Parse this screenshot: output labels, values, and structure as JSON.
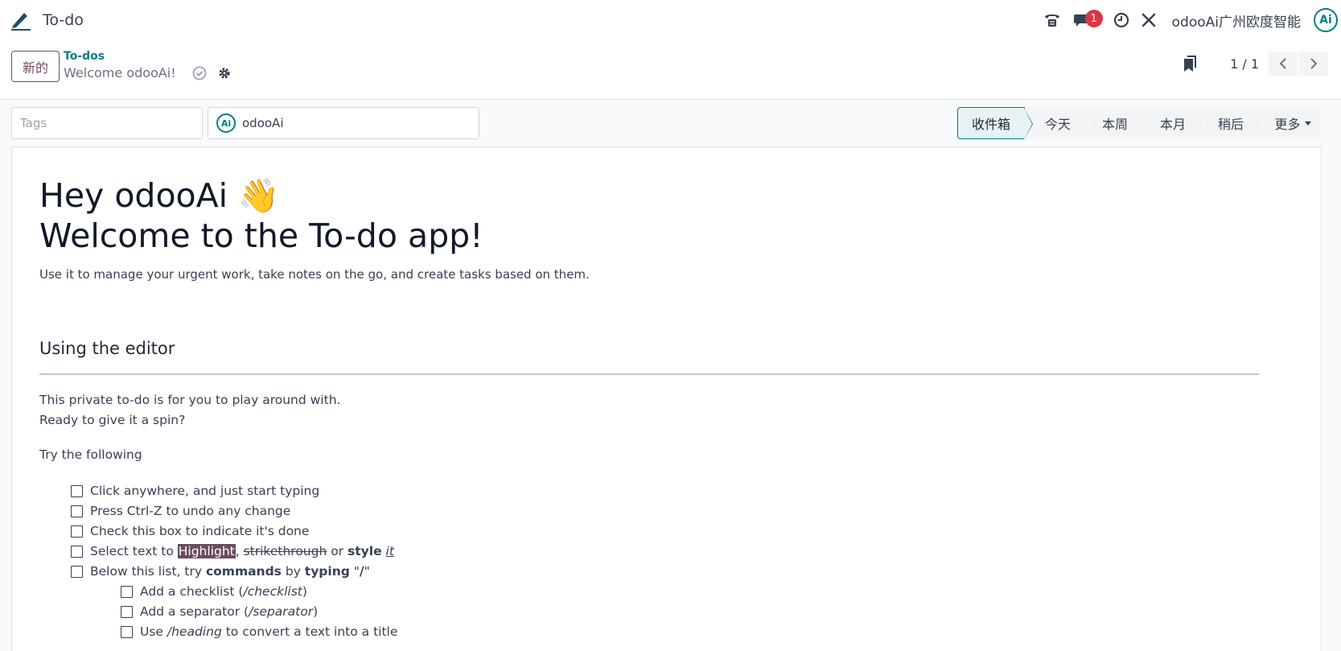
{
  "navbar": {
    "app_title": "To-do",
    "chat_badge": "1",
    "company": "odooAi广州欧度智能",
    "avatar": "Ai"
  },
  "control": {
    "new_button": "新的",
    "breadcrumb": "To-dos",
    "record_title": "Welcome odooAi!",
    "pager": "1 / 1"
  },
  "fields": {
    "tags_placeholder": "Tags",
    "assignee": "odooAi",
    "assignee_avatar": "Ai"
  },
  "stages": [
    {
      "label": "收件箱",
      "active": true
    },
    {
      "label": "今天"
    },
    {
      "label": "本周"
    },
    {
      "label": "本月"
    },
    {
      "label": "稍后"
    },
    {
      "label": "更多"
    }
  ],
  "content": {
    "heading_line1": "Hey odooAi 👋",
    "heading_line2": "Welcome to the To-do app!",
    "lead": "Use it to manage your urgent work, take notes on the go, and create tasks based on them.",
    "section_title": "Using the editor",
    "intro_line1": "This private to-do is for you to play around with.",
    "intro_line2": "Ready to give it a spin?",
    "try_label": "Try the following",
    "items": {
      "item1": "Click anywhere, and just start typing",
      "item2": "Press Ctrl-Z to undo any change",
      "item3": "Check this box to indicate it's done",
      "item4_a": "Select text to ",
      "item4_highlight": "Highlight",
      "item4_comma": ", ",
      "item4_strike": "strikethrough",
      "item4_or": " or ",
      "item4_style": "style",
      "item4_space": " ",
      "item4_it": "it",
      "item5_a": "Below this list, try ",
      "item5_commands": "commands",
      "item5_by": " by ",
      "item5_typing": "typing",
      "item5_quote": " \"",
      "item5_slash": "/",
      "item5_endquote": "\"",
      "sub1_a": "Add a checklist (",
      "sub1_cmd": "/checklist",
      "sub1_b": ")",
      "sub2_a": "Add a separator (",
      "sub2_cmd": "/separator",
      "sub2_b": ")",
      "sub3_a": "Use ",
      "sub3_cmd": "/heading",
      "sub3_b": " to convert a text into a title"
    }
  },
  "colors": {
    "brand": "#714b67",
    "accent": "#017e84",
    "highlight_bg": "#6b4c5e",
    "badge": "#dc3545"
  }
}
